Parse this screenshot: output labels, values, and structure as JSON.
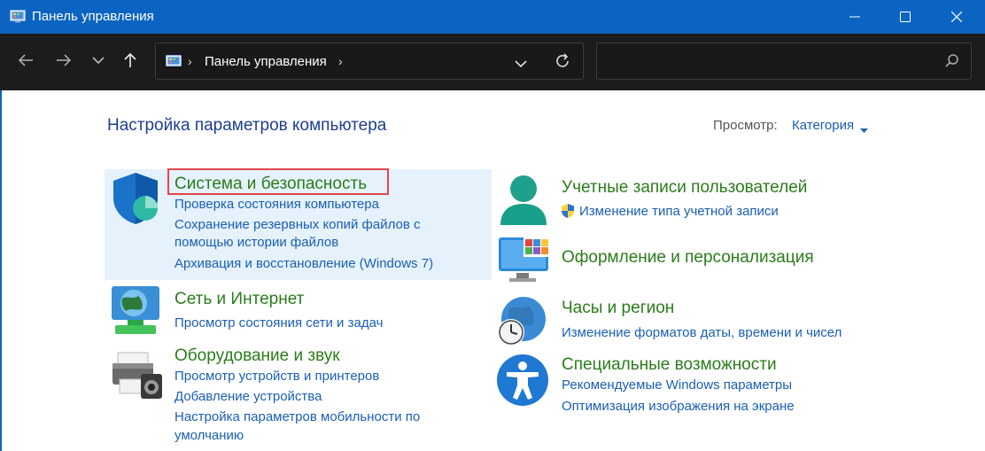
{
  "window": {
    "title": "Панель управления"
  },
  "address": {
    "path": "Панель управления",
    "search_value": ""
  },
  "main": {
    "heading": "Настройка параметров компьютера",
    "view_label": "Просмотр:",
    "view_value": "Категория"
  },
  "categories": {
    "system": {
      "title": "Система и безопасность",
      "links": [
        "Проверка состояния компьютера",
        "Сохранение резервных копий файлов с",
        "помощью истории файлов",
        "Архивация и восстановление (Windows 7)"
      ]
    },
    "network": {
      "title": "Сеть и Интернет",
      "links": [
        "Просмотр состояния сети и задач"
      ]
    },
    "hardware": {
      "title": "Оборудование и звук",
      "links": [
        "Просмотр устройств и принтеров",
        "Добавление устройства",
        "Настройка параметров мобильности по",
        "умолчанию"
      ]
    },
    "accounts": {
      "title": "Учетные записи пользователей",
      "links": [
        "Изменение типа учетной записи"
      ]
    },
    "appearance": {
      "title": "Оформление и персонализация"
    },
    "clock": {
      "title": "Часы и регион",
      "links": [
        "Изменение форматов даты, времени и чисел"
      ]
    },
    "access": {
      "title": "Специальные возможности",
      "links": [
        "Рекомендуемые Windows параметры",
        "Оптимизация изображения на экране"
      ]
    }
  },
  "colors": {
    "titlebar": "#0b64c1",
    "navbar": "#1c1c1c",
    "category_title": "#2a7d1a",
    "link": "#1a5fb4",
    "heading": "#1e3e8f",
    "highlight": "#e5f1fb",
    "focus_box": "#e0474c"
  },
  "icons": {
    "app": "control-panel-icon",
    "back": "arrow-left-icon",
    "forward": "arrow-right-icon",
    "recent": "chevron-down-icon",
    "up": "arrow-up-icon",
    "refresh": "refresh-icon",
    "search": "search-icon"
  }
}
